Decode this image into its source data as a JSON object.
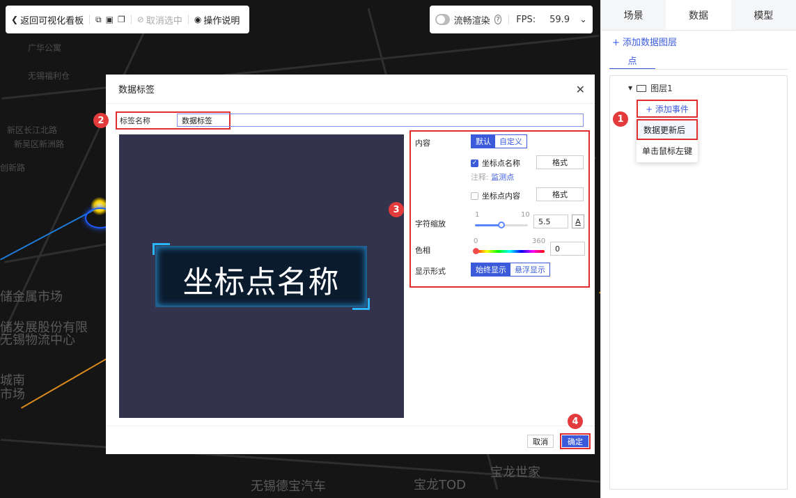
{
  "toolbar": {
    "back_label": "返回可视化看板",
    "deselect_label": "取消选中",
    "help_label": "操作说明",
    "icons": [
      "back-icon",
      "single-select-icon",
      "multi-select-icon",
      "copy-icon",
      "deselect-icon",
      "lightbulb-icon"
    ]
  },
  "render_bar": {
    "smooth_label": "流畅渲染",
    "fps_label": "FPS:",
    "fps_value": "59.9"
  },
  "map": {
    "labels": [
      "广华公寓",
      "无锡福利仓",
      "新区长江北路",
      "新吴区新洲路",
      "创新路",
      "储金属市场",
      "储发展股份有限",
      "无锡物流中心",
      "城南",
      "市场",
      "无锡德宝汽车",
      "宝龙TOD",
      "宝龙世家"
    ]
  },
  "panel": {
    "tabs": [
      "场景",
      "数据",
      "模型"
    ],
    "active_tab": "数据",
    "add_layer_label": "+ 添加数据图层",
    "subtab_label": "点",
    "tree_node_label": "图层1",
    "add_event_label": "+ 添加事件",
    "menu": [
      "数据更新后",
      "单击鼠标左键"
    ]
  },
  "modal": {
    "title": "数据标签",
    "name_label": "标签名称",
    "name_value": "数据标签",
    "preview_text": "坐标点名称",
    "content_label": "内容",
    "content_options": [
      "默认",
      "自定义"
    ],
    "content_selected": "默认",
    "coord_name_label": "坐标点名称",
    "coord_name_checked": true,
    "format_label": "格式",
    "note_prefix": "注释:",
    "note_link": "监测点",
    "coord_content_label": "坐标点内容",
    "coord_content_checked": false,
    "scale_label": "字符缩放",
    "scale_min": "1",
    "scale_max": "10",
    "scale_value": "5.5",
    "scale_fraction": 0.5,
    "a_button": "A",
    "hue_label": "色相",
    "hue_min": "0",
    "hue_max": "360",
    "hue_value": "0",
    "display_label": "显示形式",
    "display_options": [
      "始终显示",
      "悬浮显示"
    ],
    "display_selected": "始终显示",
    "cancel_label": "取消",
    "ok_label": "确定"
  },
  "badges": [
    "1",
    "2",
    "3",
    "4"
  ],
  "colors": {
    "accent": "#3b5bdb",
    "highlight": "#e02d2d",
    "preview_bg": "#33334d"
  }
}
